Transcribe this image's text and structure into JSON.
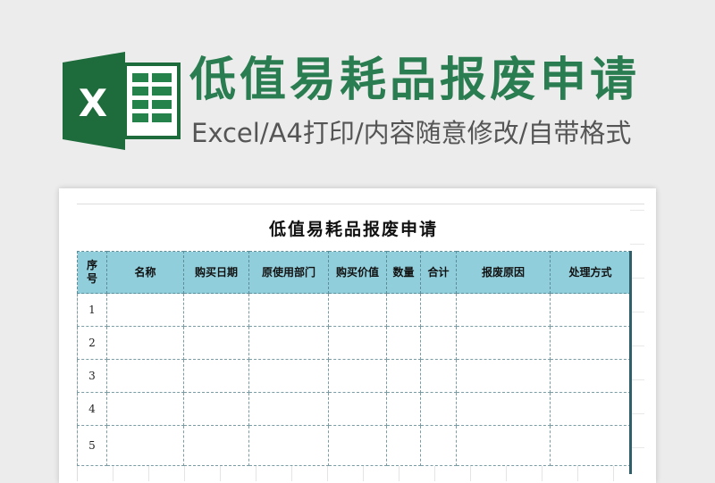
{
  "header": {
    "title": "低值易耗品报废申请",
    "subtitle": "Excel/A4打印/内容随意修改/自带格式",
    "logo_letter": "X",
    "colors": {
      "title": "#2a7d50",
      "logo_dark": "#1e6b3b",
      "logo_light": "#24824a",
      "table_header": "#90cedb"
    }
  },
  "sheet": {
    "title": "低值易耗品报废申请",
    "columns": [
      "序号",
      "名称",
      "购买日期",
      "原使用部门",
      "购买价值",
      "数量",
      "合计",
      "报废原因",
      "处理方式"
    ],
    "rows": [
      {
        "no": "1"
      },
      {
        "no": "2"
      },
      {
        "no": "3"
      },
      {
        "no": "4"
      },
      {
        "no": "5"
      }
    ]
  }
}
